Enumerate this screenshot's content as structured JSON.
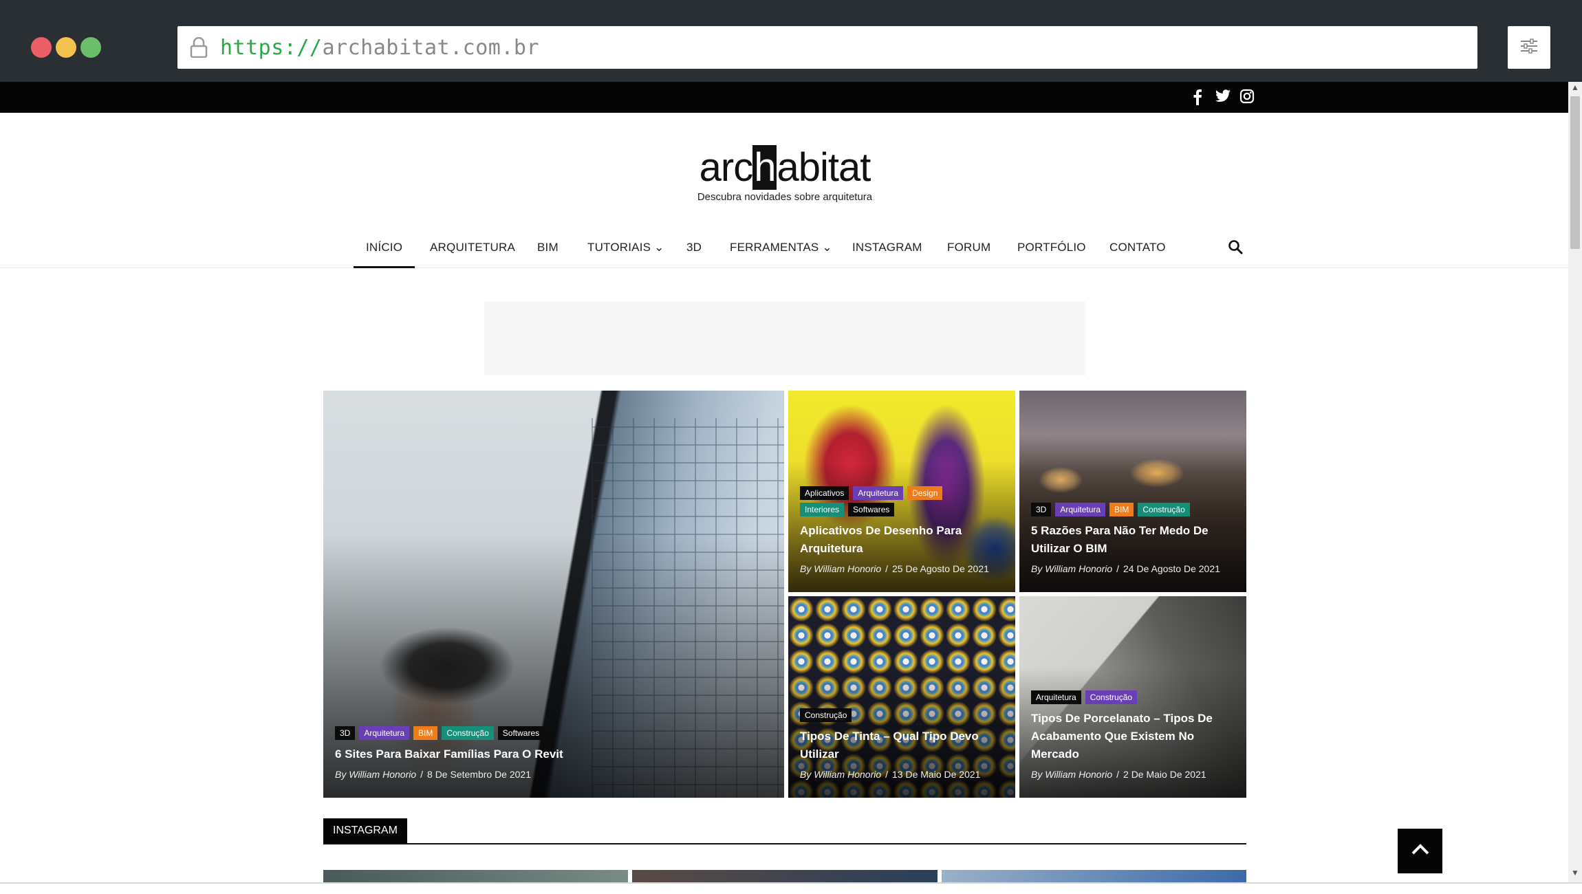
{
  "browser": {
    "url_scheme": "https://",
    "url_host": "archabitat.com.br"
  },
  "site": {
    "logo_prefix": "arc",
    "logo_h": "h",
    "logo_suffix": "abitat",
    "tagline": "Descubra novidades sobre arquitetura"
  },
  "nav": {
    "items": [
      {
        "label": "INÍCIO"
      },
      {
        "label": "ARQUITETURA"
      },
      {
        "label": "BIM"
      },
      {
        "label": "TUTORIAIS ⌄"
      },
      {
        "label": "3D"
      },
      {
        "label": "FERRAMENTAS ⌄"
      },
      {
        "label": "INSTAGRAM"
      },
      {
        "label": "FORUM"
      },
      {
        "label": "PORTFÓLIO"
      },
      {
        "label": "CONTATO"
      }
    ]
  },
  "social": [
    "facebook-icon",
    "twitter-icon",
    "instagram-icon"
  ],
  "colors": {
    "tag_black": "#0b0b0b",
    "tag_purple": "#6a3fb5",
    "tag_orange": "#f07b1a",
    "tag_teal": "#168f7a"
  },
  "posts": [
    {
      "tags": [
        "3D",
        "Arquitetura",
        "BIM",
        "Construção",
        "Softwares"
      ],
      "title": "6 Sites Para Baixar Famílias Para O Revit",
      "author": "By William Honorio",
      "date": "8 De Setembro De 2021"
    },
    {
      "tags": [
        "Aplicativos",
        "Arquitetura",
        "Design",
        "Interiores",
        "Softwares"
      ],
      "title": "Aplicativos De Desenho Para Arquitetura",
      "author": "By William Honorio",
      "date": "25 De Agosto De 2021"
    },
    {
      "tags": [
        "3D",
        "Arquitetura",
        "BIM",
        "Construção"
      ],
      "title": "5 Razões Para Não Ter Medo De Utilizar O BIM",
      "author": "By William Honorio",
      "date": "24 De Agosto De 2021"
    },
    {
      "tags": [
        "Construção"
      ],
      "title": "Tipos De Tinta – Qual Tipo Devo Utilizar",
      "author": "By William Honorio",
      "date": "13 De Maio De 2021"
    },
    {
      "tags": [
        "Arquitetura",
        "Construção"
      ],
      "title": "Tipos De Porcelanato – Tipos De Acabamento Que Existem No Mercado",
      "author": "By William Honorio",
      "date": "2 De Maio De 2021"
    }
  ],
  "instagram_section": {
    "label": "INSTAGRAM"
  }
}
